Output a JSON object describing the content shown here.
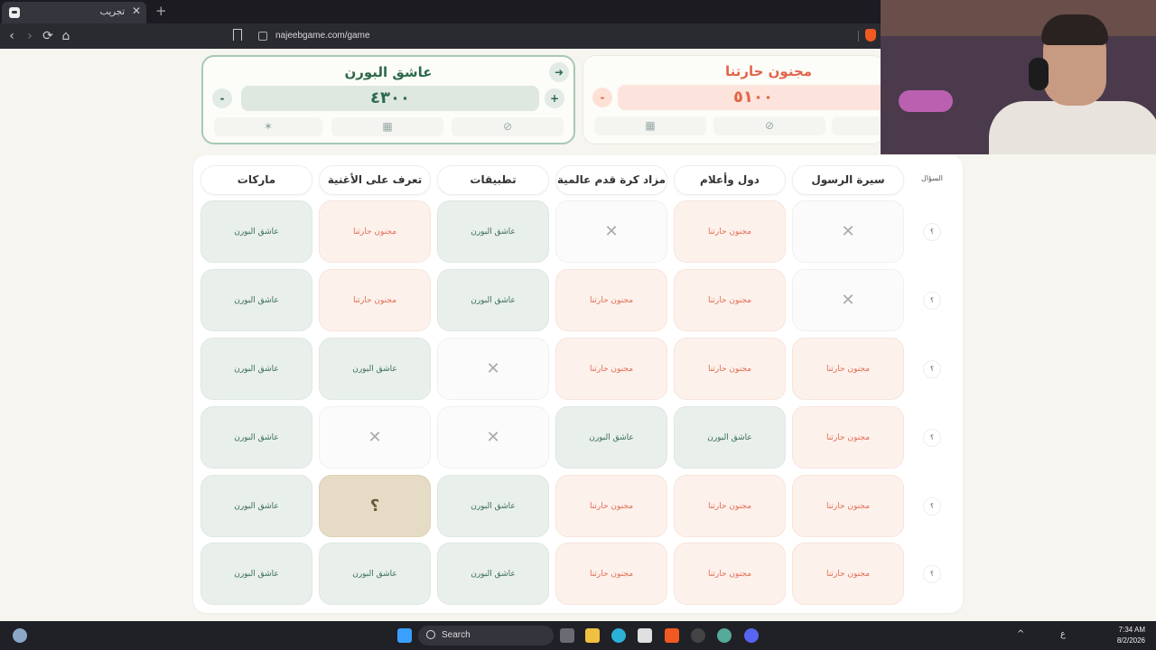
{
  "browser": {
    "tab_title": "تجريب",
    "tab_close": "✕",
    "new_tab": "+",
    "url": "najeebgame.com/game",
    "back": "‹",
    "forward": "›",
    "reload": "⟳",
    "home": "⌂"
  },
  "teams": {
    "a": {
      "name": "عاشق البورن",
      "score": "٤٣٠٠",
      "plus": "+",
      "minus": "-",
      "turn_arrow": "➜",
      "active": true,
      "color": "#2e6a4b"
    },
    "b": {
      "name": "مجنون حارتنا",
      "score": "٥١٠٠",
      "minus": "-",
      "color": "#e2654b"
    },
    "tools": {
      "magic": "✶",
      "card": "▦",
      "block": "⊘"
    }
  },
  "board": {
    "question_label": "السؤال",
    "categories": [
      "سيرة الرسول",
      "دول وأعلام",
      "مزاد كرة قدم عالمية",
      "تطبيقات",
      "تعرف على الأغنية",
      "ماركات"
    ],
    "row_marker": "؟",
    "unrevealed_mark": "؟",
    "used_mark": "✕",
    "rows": [
      [
        "x",
        "b",
        "x",
        "a",
        "b",
        "a"
      ],
      [
        "x",
        "b",
        "b",
        "a",
        "b",
        "a"
      ],
      [
        "b",
        "b",
        "b",
        "x",
        "a",
        "a"
      ],
      [
        "b",
        "a",
        "a",
        "x",
        "x",
        "a"
      ],
      [
        "b",
        "b",
        "b",
        "a",
        "q",
        "a"
      ],
      [
        "b",
        "b",
        "b",
        "a",
        "a",
        "a"
      ]
    ],
    "team_a_cell_label": "عاشق البورن",
    "team_b_cell_label": "مجنون حارتنا"
  },
  "taskbar": {
    "search_label": "Search",
    "time": "7:34 AM",
    "date": "8/2/2026",
    "lang": "ع",
    "tray_arrow": "^"
  }
}
